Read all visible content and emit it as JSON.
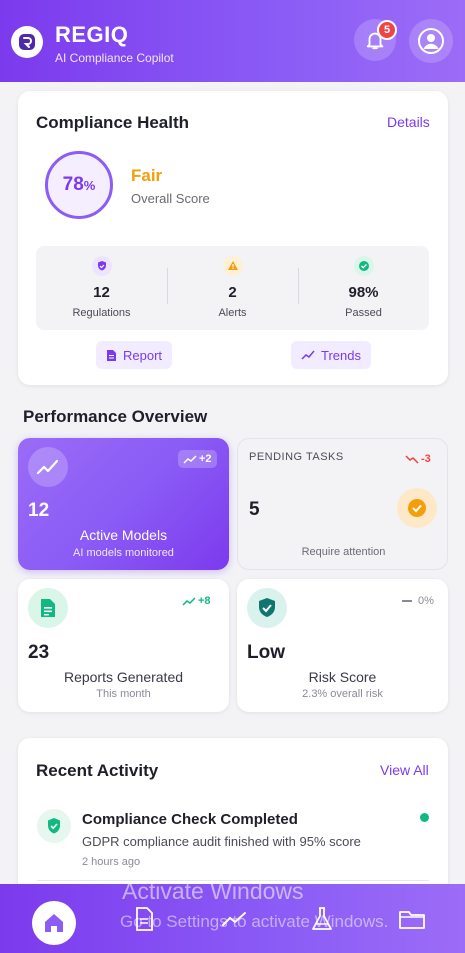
{
  "header": {
    "brand": "REGIQ",
    "tagline": "AI Compliance Copilot",
    "notification_count": "5"
  },
  "health": {
    "title": "Compliance Health",
    "details_link": "Details",
    "score": "78",
    "score_unit": "%",
    "rating": "Fair",
    "rating_label": "Overall Score",
    "stats": [
      {
        "value": "12",
        "label": "Regulations"
      },
      {
        "value": "2",
        "label": "Alerts"
      },
      {
        "value": "98%",
        "label": "Passed"
      }
    ],
    "report_button": "Report",
    "trends_button": "Trends"
  },
  "performance": {
    "title": "Performance Overview",
    "tiles": [
      {
        "number": "12",
        "label": "Active Models",
        "sub": "AI models monitored",
        "trend": "+2"
      },
      {
        "heading": "PENDING TASKS",
        "number": "5",
        "sub": "Require attention",
        "trend": "-3"
      },
      {
        "number": "23",
        "label": "Reports Generated",
        "sub": "This month",
        "trend": "+8"
      },
      {
        "number": "Low",
        "label": "Risk Score",
        "sub": "2.3% overall risk",
        "trend": "0%"
      }
    ]
  },
  "activity": {
    "title": "Recent Activity",
    "view_all": "View All",
    "items": [
      {
        "title": "Compliance Check Completed",
        "desc": "GDPR compliance audit finished with 95% score",
        "time": "2 hours ago"
      }
    ]
  },
  "watermark": {
    "line1": "Activate Windows",
    "line2": "Go to Settings to activate Windows."
  },
  "colors": {
    "primary": "#7c3aed",
    "accent_light": "#8b5cf6",
    "warning": "#f59e0b",
    "success": "#10b981",
    "danger": "#ef4444"
  }
}
